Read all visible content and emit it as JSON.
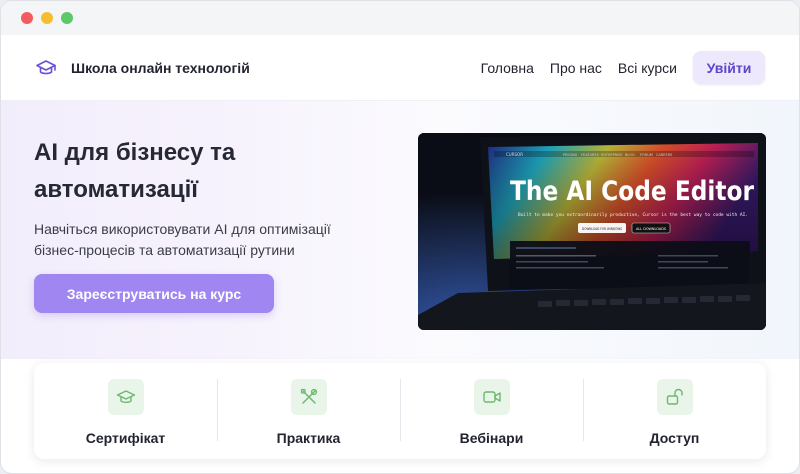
{
  "window": {
    "controls": [
      "close",
      "minimize",
      "maximize"
    ]
  },
  "header": {
    "brand_icon": "graduation-cap-icon",
    "brand_name": "Школа онлайн технологій",
    "nav": [
      "Головна",
      "Про нас",
      "Всі курси"
    ],
    "login_label": "Увійти"
  },
  "hero": {
    "title": "AI для бізнесу та автоматизації",
    "subtitle": "Навчіться використовувати AI для оптимізації бізнес-процесів та автоматизації рутини",
    "cta_label": "Зареєструватись на курс",
    "image": {
      "headline": "The AI Code Editor",
      "tagline": "Built to make you extraordinarily productive, Cursor is the best way to code with AI.",
      "download_label": "DOWNLOAD FOR WINDOWS",
      "all_label": "ALL DOWNLOADS",
      "logo_text": "CURSOR",
      "menu": [
        "PRICING",
        "FEATURES",
        "ENTERPRISE",
        "BLOG",
        "FORUM",
        "CAREERS"
      ]
    }
  },
  "features": [
    {
      "label": "Сертифікат",
      "icon": "graduation-cap-icon"
    },
    {
      "label": "Практика",
      "icon": "tools-icon"
    },
    {
      "label": "Вебінари",
      "icon": "video-camera-icon"
    },
    {
      "label": "Доступ",
      "icon": "unlock-icon"
    }
  ],
  "colors": {
    "accent": "#a086f1",
    "accent_light": "#ede8fb",
    "feature_icon_bg": "#eaf5ea",
    "feature_icon_fg": "#6cb86f"
  }
}
